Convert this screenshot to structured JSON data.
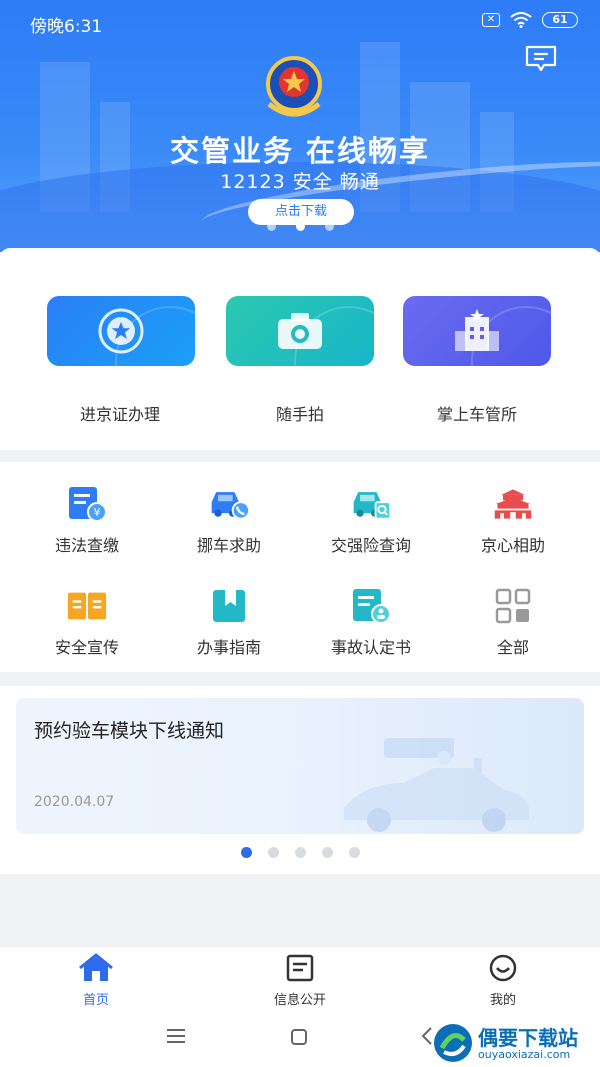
{
  "status": {
    "time": "傍晚6:31",
    "battery": "61"
  },
  "banner": {
    "title": "交管业务 在线畅享",
    "subtitle": "12123 安全 畅通",
    "download_label": "点击下载",
    "active_dot": 1
  },
  "main_cards": [
    {
      "label": "进京证办理",
      "icon": "star-badge-icon",
      "color_from": "#2a7ff5",
      "color_to": "#1aa0f8"
    },
    {
      "label": "随手拍",
      "icon": "camera-icon",
      "color_from": "#2dc8b0",
      "color_to": "#16b6c9"
    },
    {
      "label": "掌上车管所",
      "icon": "building-icon",
      "color_from": "#6a6cf2",
      "color_to": "#4e58e8"
    }
  ],
  "grid": [
    {
      "label": "违法查缴",
      "icon": "fine-payment-icon"
    },
    {
      "label": "挪车求助",
      "icon": "car-call-icon"
    },
    {
      "label": "交强险查询",
      "icon": "insurance-search-icon"
    },
    {
      "label": "京心相助",
      "icon": "tiananmen-icon"
    },
    {
      "label": "安全宣传",
      "icon": "open-book-icon"
    },
    {
      "label": "办事指南",
      "icon": "bookmark-icon"
    },
    {
      "label": "事故认定书",
      "icon": "accident-doc-icon"
    },
    {
      "label": "全部",
      "icon": "grid-all-icon"
    }
  ],
  "notice": {
    "title": "预约验车模块下线通知",
    "date": "2020.04.07",
    "active_dot": 0
  },
  "tabs": [
    {
      "label": "首页",
      "icon": "home-icon",
      "active": true
    },
    {
      "label": "信息公开",
      "icon": "document-icon",
      "active": false
    },
    {
      "label": "我的",
      "icon": "smile-icon",
      "active": false
    }
  ],
  "watermark": {
    "title": "偶要下载站",
    "url": "ouyaoxiazai.com"
  },
  "colors": {
    "primary": "#2e7cf6",
    "active_tab": "#2e6bea",
    "orange": "#f5a623",
    "red": "#e84d4d"
  }
}
